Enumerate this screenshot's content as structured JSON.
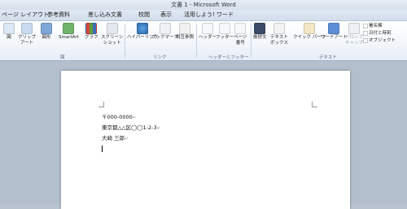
{
  "window": {
    "title": "文書 1 - Microsoft Word"
  },
  "tabs": [
    "ページ レイアウト",
    "参考資料",
    "差し込み文書",
    "校閲",
    "表示",
    "活用しよう! ワード"
  ],
  "ribbon": {
    "buttons": {
      "pic": "図",
      "clipart": "クリップ\nアート",
      "shapes": "図形",
      "smartart": "SmartArt",
      "graph": "グラフ",
      "screenshot": "スクリーン\nショット",
      "hyperlink": "ハイパーリンク",
      "bookmark": "ブックマーク",
      "crossref": "相互参照",
      "header": "ヘッダー",
      "footer": "フッター",
      "pagenum": "ページ\n番号",
      "textbox_jp": "挨拶文",
      "textbox": "テキスト\nボックス",
      "quickparts": "クイック パーツ",
      "wordart": "ワードアート",
      "dropcap": "ドロップ\nキャップ"
    },
    "small": {
      "signature": "署名欄",
      "datetime": "日付と時刻",
      "object": "オブジェクト"
    },
    "groups": {
      "illustrations": "図",
      "links": "リンク",
      "headerfooter": "ヘッダーとフッター",
      "text": "テキスト"
    }
  },
  "document": {
    "lines": [
      "〒000-0000",
      "東京都△△区◯◯1-2-3",
      "大崎 三郎"
    ],
    "mark": "↵"
  }
}
